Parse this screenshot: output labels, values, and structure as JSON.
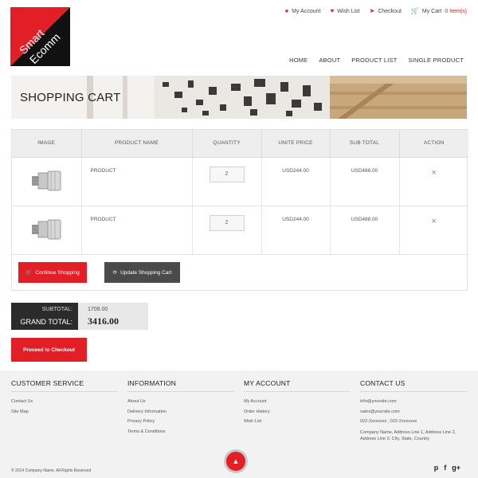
{
  "top_links": [
    {
      "label": "My Account",
      "icon": "user-icon"
    },
    {
      "label": "Wish List",
      "icon": "heart-icon"
    },
    {
      "label": "Checkout",
      "icon": "arrow-circle-icon"
    },
    {
      "label": "My Cart",
      "icon": "cart-icon",
      "count": "0 Item(s)"
    }
  ],
  "logo": {
    "line1": "Smart",
    "line2": "Ecomm"
  },
  "nav": [
    "HOME",
    "ABOUT",
    "PRODUCT LIST",
    "SINGLE PRODUCT"
  ],
  "banner": {
    "title": "SHOPPING CART"
  },
  "cart": {
    "headers": [
      "IMAGE",
      "PRODUCT NAME",
      "QUANTITY",
      "UNITE PRICE",
      "SUB TOTAL",
      "ACTION"
    ],
    "rows": [
      {
        "name": "PRODUCT",
        "qty": "2",
        "price": "USD244.00",
        "subtotal": "USD488.00",
        "action": "×"
      },
      {
        "name": "PRODUCT",
        "qty": "2",
        "price": "USD244.00",
        "subtotal": "USD488.00",
        "action": "×"
      }
    ],
    "continue_label": "Continue Shopping",
    "update_label": "Update Shopping Cart"
  },
  "totals": {
    "subtotal_label": "SUBTOTAL:",
    "subtotal_value": "1708.00",
    "grand_label": "GRAND TOTAL:",
    "grand_value": "3416.00"
  },
  "checkout_label": "Proceed to Checkout",
  "footer": {
    "customer_service": {
      "title": "CUSTOMER SERVICE",
      "links": [
        "Contact Us",
        "Site Map"
      ]
    },
    "information": {
      "title": "INFORMATION",
      "links": [
        "About Us",
        "Delivery Information",
        "Privacy Policy",
        "Terms & Conditions"
      ]
    },
    "my_account": {
      "title": "MY ACCOUNT",
      "links": [
        "My Account",
        "Order History",
        "Wish List"
      ]
    },
    "contact": {
      "title": "CONTACT US",
      "email1": "info@yoursite.com",
      "email2": "sales@yoursite.com",
      "phone": "022-2xxxxxxx , 022-2xxxxxxx",
      "address1": "Company Name, Address Line 1, Address Line 2,",
      "address2": "Address Line 3, City, State, Country"
    },
    "copyright": "© 2014 Company Name. All Rights Reserved",
    "social": [
      "p",
      "f",
      "g+"
    ]
  },
  "colors": {
    "accent": "#e21f26",
    "dark": "#2b2b2b",
    "footer_bg": "#f2f2f2"
  }
}
